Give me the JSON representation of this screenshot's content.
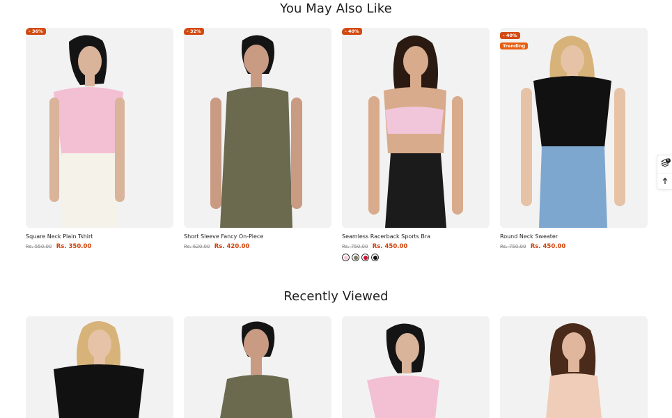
{
  "sections": {
    "you_may_also_like": {
      "title": "You May Also Like",
      "products": [
        {
          "name": "Square Neck Plain Tshirt",
          "old_price": "Rs. 550.00",
          "new_price": "Rs. 350.00",
          "discount": "- 36%",
          "tag": ""
        },
        {
          "name": "Short Sleeve Fancy On-Piece",
          "old_price": "Rs. 620.00",
          "new_price": "Rs. 420.00",
          "discount": "- 32%",
          "tag": ""
        },
        {
          "name": "Seamless Racerback Sports Bra",
          "old_price": "Rs. 750.00",
          "new_price": "Rs. 450.00",
          "discount": "- 40%",
          "tag": "",
          "swatches": [
            "#f6c9d8",
            "#7a7a62",
            "#c41230",
            "#111111"
          ]
        },
        {
          "name": "Round Neck Sweater",
          "old_price": "Rs. 750.00",
          "new_price": "Rs. 450.00",
          "discount": "- 40%",
          "tag": "Trending"
        }
      ]
    },
    "recently_viewed": {
      "title": "Recently Viewed"
    }
  },
  "floating_tools": {
    "compare_count": "0",
    "icons": [
      "layers-icon",
      "arrow-up-icon"
    ]
  },
  "colors": {
    "badge": "#d24b12",
    "sale_price": "#d2430a",
    "image_bg": "#f2f2f2"
  }
}
